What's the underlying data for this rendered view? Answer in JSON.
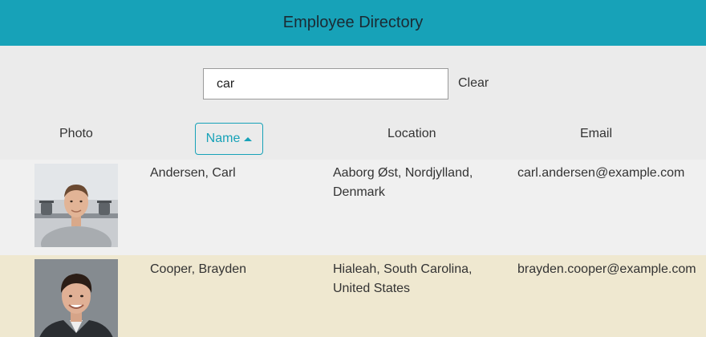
{
  "header": {
    "title": "Employee Directory",
    "background": "#17a2b8"
  },
  "search": {
    "value": "car",
    "clear_label": "Clear"
  },
  "table": {
    "columns": {
      "photo": "Photo",
      "name": "Name",
      "location": "Location",
      "email": "Email"
    },
    "sort": {
      "column": "Name",
      "direction": "ascending",
      "icon": "caret-up-icon"
    },
    "rows": [
      {
        "name": "Andersen, Carl",
        "location": "Aaborg Øst, Nordjylland, Denmark",
        "email": "carl.andersen@example.com",
        "background": "#f0f0f0"
      },
      {
        "name": "Cooper, Brayden",
        "location": "Hialeah, South Carolina, United States",
        "email": "brayden.cooper@example.com",
        "background": "#efe8d0"
      }
    ]
  },
  "colors": {
    "accent": "#17a2b8",
    "page_background": "#ebebeb"
  }
}
